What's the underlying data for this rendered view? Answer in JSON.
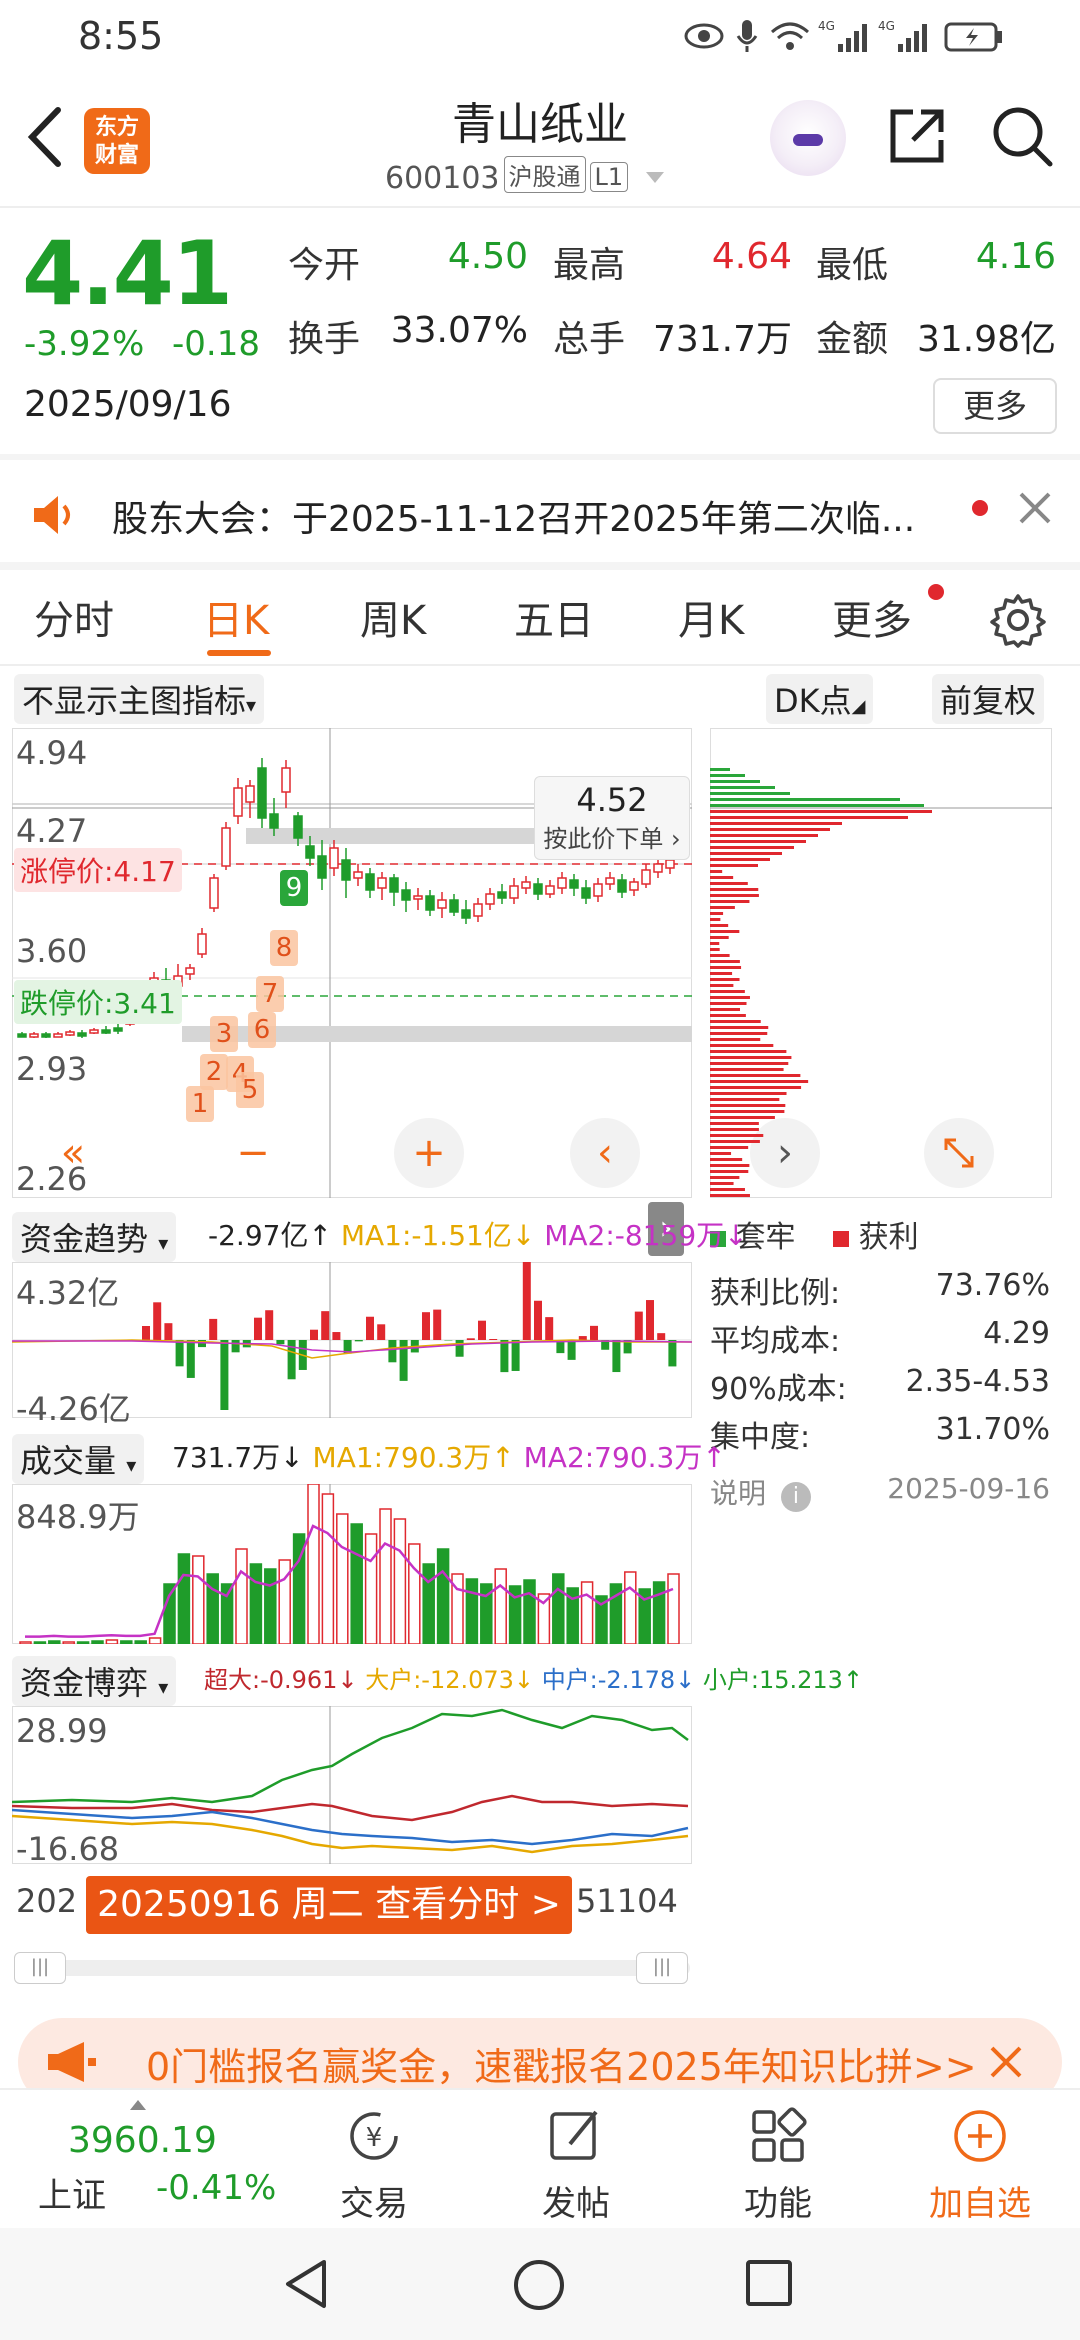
{
  "status_bar": {
    "time": "8:55"
  },
  "header": {
    "logo_text_1": "东方",
    "logo_text_2": "财富",
    "stock_name": "青山纸业",
    "stock_code": "600103",
    "tag_hgt": "沪股通",
    "tag_l1": "L1"
  },
  "quote": {
    "price": "4.41",
    "change_pct": "-3.92%",
    "change": "-0.18",
    "date": "2025/09/16",
    "open_label": "今开",
    "open": "4.50",
    "high_label": "最高",
    "high": "4.64",
    "low_label": "最低",
    "low": "4.16",
    "turnover_label": "换手",
    "turnover": "33.07%",
    "volume_label": "总手",
    "volume": "731.7万",
    "amount_label": "金额",
    "amount": "31.98亿",
    "more_label": "更多"
  },
  "notice": {
    "text": "股东大会：于2025-11-12召开2025年第二次临..."
  },
  "tabs": [
    {
      "label": "分时"
    },
    {
      "label": "日K"
    },
    {
      "label": "周K"
    },
    {
      "label": "五日"
    },
    {
      "label": "月K"
    },
    {
      "label": "更多"
    }
  ],
  "chart": {
    "indicator_select": "不显示主图指标",
    "dk_select": "DK点",
    "adjust_select": "前复权",
    "y_ticks": [
      "4.94",
      "4.27",
      "3.60",
      "2.93",
      "2.26"
    ],
    "limit_up": "涨停价:4.17",
    "limit_down": "跌停价:3.41",
    "order_price": "4.52",
    "order_hint": "按此价下单",
    "markers": [
      "1",
      "2",
      "4",
      "5",
      "3",
      "6",
      "7",
      "8",
      "9"
    ]
  },
  "fund_trend": {
    "select": "资金趋势",
    "value": "-2.97亿↑",
    "ma1": "MA1:-1.51亿↓",
    "ma2": "MA2:-8159万↓",
    "y_top": "4.32亿",
    "y_bottom": "-4.26亿"
  },
  "volume": {
    "select": "成交量",
    "value": "731.7万↓",
    "ma1": "MA1:790.3万↑",
    "ma2": "MA2:790.3万↑",
    "y_top": "848.9万"
  },
  "fund_game": {
    "select": "资金博弈",
    "super": "超大:-0.961↓",
    "large": "大户:-12.073↓",
    "mid": "中户:-2.178↓",
    "small": "小户:15.213↑",
    "y_top": "28.99",
    "y_bottom": "-16.68",
    "x_left": "202",
    "x_right": "51104",
    "banner": "20250916 周二 查看分时 >"
  },
  "chip_panel": {
    "legend_trapped": "套牢",
    "legend_profit": "获利",
    "rows": [
      {
        "label": "获利比例:",
        "value": "73.76%"
      },
      {
        "label": "平均成本:",
        "value": "4.29"
      },
      {
        "label": "90%成本:",
        "value": "2.35-4.53"
      },
      {
        "label": "集中度:",
        "value": "31.70%"
      }
    ],
    "note_label": "说明",
    "note_date": "2025-09-16"
  },
  "promo": {
    "text": "0门槛报名赢奖金，速戳报名2025年知识比拼>>"
  },
  "bottom_nav": {
    "index_value": "3960.19",
    "index_name": "上证",
    "index_pct": "-0.41%",
    "items": [
      {
        "label": "交易"
      },
      {
        "label": "发帖"
      },
      {
        "label": "功能"
      },
      {
        "label": "加自选"
      }
    ]
  },
  "colors": {
    "accent": "#f06a18",
    "up": "#e0282e",
    "down": "#1f9c2a"
  }
}
